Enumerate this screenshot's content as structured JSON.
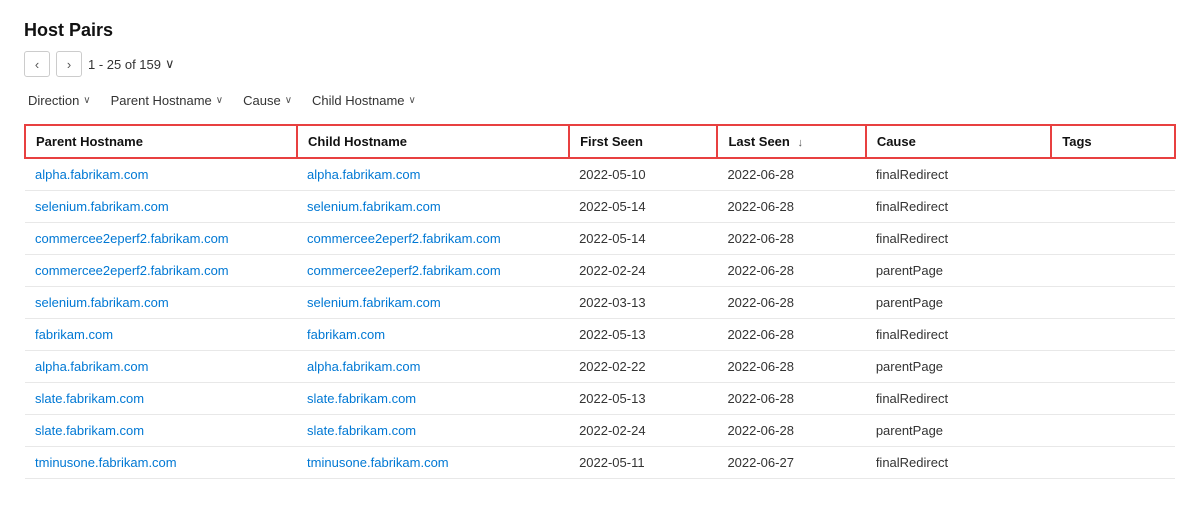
{
  "title": "Host Pairs",
  "pagination": {
    "prev_label": "‹",
    "next_label": "›",
    "range_label": "1 - 25 of 159",
    "chevron": "∨"
  },
  "filters": [
    {
      "id": "direction",
      "label": "Direction"
    },
    {
      "id": "parent-hostname",
      "label": "Parent Hostname"
    },
    {
      "id": "cause",
      "label": "Cause"
    },
    {
      "id": "child-hostname",
      "label": "Child Hostname"
    }
  ],
  "columns": [
    {
      "id": "parent-hostname",
      "label": "Parent Hostname",
      "sortable": false
    },
    {
      "id": "child-hostname",
      "label": "Child Hostname",
      "sortable": false
    },
    {
      "id": "first-seen",
      "label": "First Seen",
      "sortable": false
    },
    {
      "id": "last-seen",
      "label": "Last Seen",
      "sortable": true,
      "sort_icon": "↓"
    },
    {
      "id": "cause",
      "label": "Cause",
      "sortable": false
    },
    {
      "id": "tags",
      "label": "Tags",
      "sortable": false
    }
  ],
  "rows": [
    {
      "parent": "alpha.fabrikam.com",
      "child": "alpha.fabrikam.com",
      "first_seen": "2022-05-10",
      "last_seen": "2022-06-28",
      "cause": "finalRedirect",
      "tags": ""
    },
    {
      "parent": "selenium.fabrikam.com",
      "child": "selenium.fabrikam.com",
      "first_seen": "2022-05-14",
      "last_seen": "2022-06-28",
      "cause": "finalRedirect",
      "tags": ""
    },
    {
      "parent": "commercee2eperf2.fabrikam.com",
      "child": "commercee2eperf2.fabrikam.com",
      "first_seen": "2022-05-14",
      "last_seen": "2022-06-28",
      "cause": "finalRedirect",
      "tags": ""
    },
    {
      "parent": "commercee2eperf2.fabrikam.com",
      "child": "commercee2eperf2.fabrikam.com",
      "first_seen": "2022-02-24",
      "last_seen": "2022-06-28",
      "cause": "parentPage",
      "tags": ""
    },
    {
      "parent": "selenium.fabrikam.com",
      "child": "selenium.fabrikam.com",
      "first_seen": "2022-03-13",
      "last_seen": "2022-06-28",
      "cause": "parentPage",
      "tags": ""
    },
    {
      "parent": "fabrikam.com",
      "child": "fabrikam.com",
      "first_seen": "2022-05-13",
      "last_seen": "2022-06-28",
      "cause": "finalRedirect",
      "tags": ""
    },
    {
      "parent": "alpha.fabrikam.com",
      "child": "alpha.fabrikam.com",
      "first_seen": "2022-02-22",
      "last_seen": "2022-06-28",
      "cause": "parentPage",
      "tags": ""
    },
    {
      "parent": "slate.fabrikam.com",
      "child": "slate.fabrikam.com",
      "first_seen": "2022-05-13",
      "last_seen": "2022-06-28",
      "cause": "finalRedirect",
      "tags": ""
    },
    {
      "parent": "slate.fabrikam.com",
      "child": "slate.fabrikam.com",
      "first_seen": "2022-02-24",
      "last_seen": "2022-06-28",
      "cause": "parentPage",
      "tags": ""
    },
    {
      "parent": "tminusone.fabrikam.com",
      "child": "tminusone.fabrikam.com",
      "first_seen": "2022-05-11",
      "last_seen": "2022-06-27",
      "cause": "finalRedirect",
      "tags": ""
    }
  ]
}
